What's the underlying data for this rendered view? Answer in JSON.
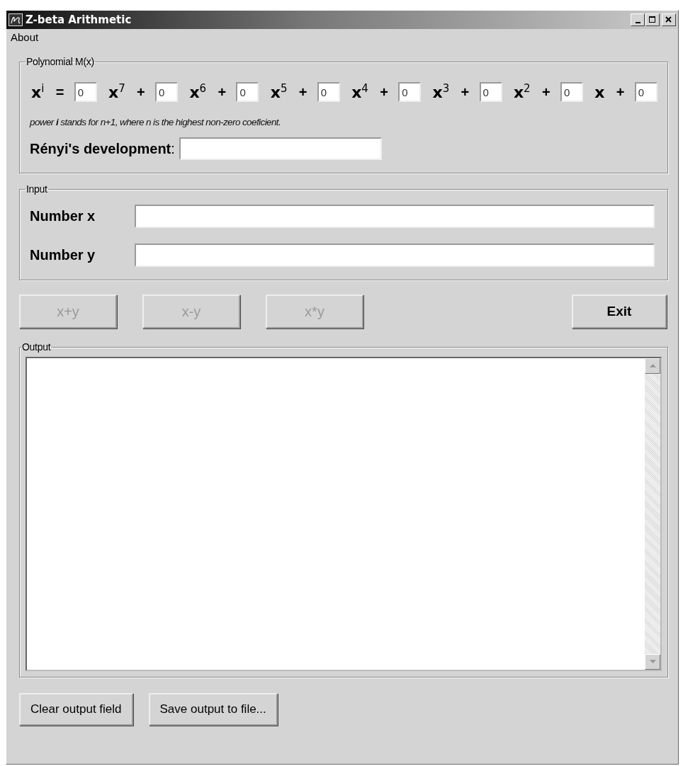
{
  "window": {
    "title": "Z-beta Arithmetic"
  },
  "menu": [
    {
      "label": "About"
    }
  ],
  "polynomial": {
    "legend": "Polynomial M(x)",
    "lhs": {
      "variable": "x",
      "power": "i"
    },
    "equals": "=",
    "terms": [
      {
        "coefficient": "0",
        "variable": "x",
        "power": "7",
        "plus": "+"
      },
      {
        "coefficient": "0",
        "variable": "x",
        "power": "6",
        "plus": "+"
      },
      {
        "coefficient": "0",
        "variable": "x",
        "power": "5",
        "plus": "+"
      },
      {
        "coefficient": "0",
        "variable": "x",
        "power": "4",
        "plus": "+"
      },
      {
        "coefficient": "0",
        "variable": "x",
        "power": "3",
        "plus": "+"
      },
      {
        "coefficient": "0",
        "variable": "x",
        "power": "2",
        "plus": "+"
      },
      {
        "coefficient": "0",
        "variable": "x",
        "plus": "+"
      },
      {
        "coefficient": "0"
      }
    ],
    "note": "power **i** stands for n+1, where n is the highest non-zero coeficient.",
    "development_label": "**Rényi's development**:"
  },
  "input": {
    "legend": "Input",
    "fields": [
      {
        "label": "Number x"
      },
      {
        "label": "Number y"
      }
    ]
  },
  "operations": [
    {
      "label": "x+y",
      "disabled": true
    },
    {
      "label": "x-y",
      "disabled": true
    },
    {
      "label": "x*y",
      "disabled": true
    }
  ],
  "exit_button": {
    "label": "Exit"
  },
  "output": {
    "legend": "Output"
  },
  "bottom_buttons": [
    {
      "label": "Clear output field"
    },
    {
      "label": "Save output to file..."
    }
  ]
}
